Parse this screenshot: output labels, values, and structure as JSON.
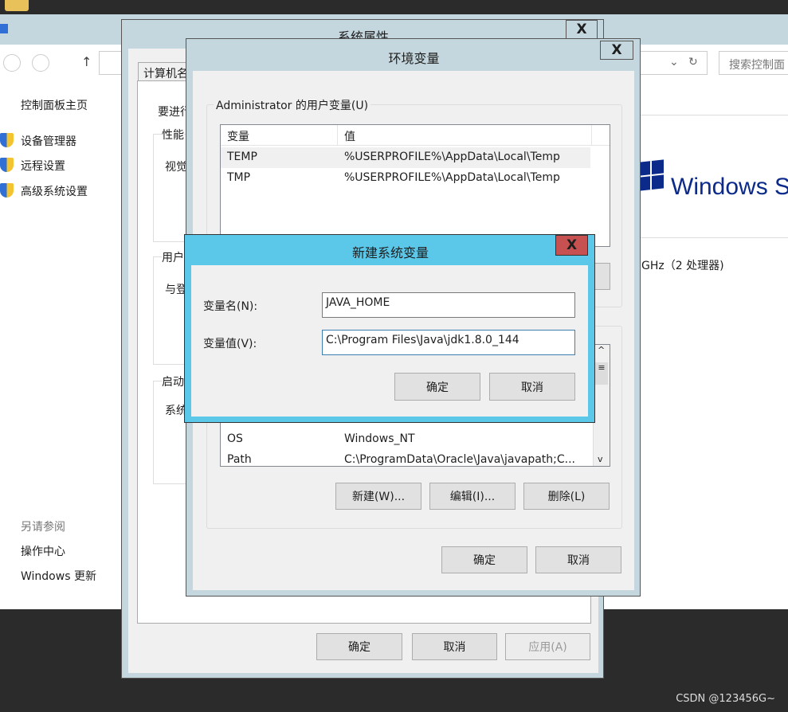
{
  "control_panel": {
    "nav": {
      "home": "控制面板主页",
      "items": [
        "设备管理器",
        "远程设置",
        "高级系统设置"
      ],
      "see_also": "另请参阅",
      "links": [
        "操作中心",
        "Windows 更新"
      ]
    },
    "search_placeholder": "搜索控制面",
    "brand": "Windows Se",
    "cpu_info": "GHz（2 处理器)"
  },
  "system_properties": {
    "title": "系统属性",
    "tab": "计算机名",
    "partial_texts": [
      "要进行",
      "性能",
      "视觉",
      "用户",
      "与登",
      "启动",
      "系统"
    ],
    "buttons": {
      "ok": "确定",
      "cancel": "取消",
      "apply": "应用(A)"
    }
  },
  "env_vars": {
    "title": "环境变量",
    "user_group": "Administrator 的用户变量(U)",
    "columns": [
      "变量",
      "值"
    ],
    "user_rows": [
      {
        "name": "TEMP",
        "value": "%USERPROFILE%\\AppData\\Local\\Temp"
      },
      {
        "name": "TMP",
        "value": "%USERPROFILE%\\AppData\\Local\\Temp"
      }
    ],
    "system_rows": [
      {
        "name": "OS",
        "value": "Windows_NT"
      },
      {
        "name": "Path",
        "value": "C:\\ProgramData\\Oracle\\Java\\javapath;C..."
      }
    ],
    "buttons": {
      "new": "新建(W)...",
      "edit": "编辑(I)...",
      "delete": "删除(L)",
      "ok": "确定",
      "cancel": "取消"
    }
  },
  "new_var_dialog": {
    "title": "新建系统变量",
    "name_label": "变量名(N):",
    "name_value": "JAVA_HOME",
    "value_label": "变量值(V):",
    "value_value": "C:\\Program Files\\Java\\jdk1.8.0_144",
    "ok": "确定",
    "cancel": "取消"
  },
  "watermark": "CSDN @123456G~",
  "colors": {
    "accent": "#5bc8ea",
    "close_red": "#c75050",
    "titlebar": "#c5d7de"
  }
}
